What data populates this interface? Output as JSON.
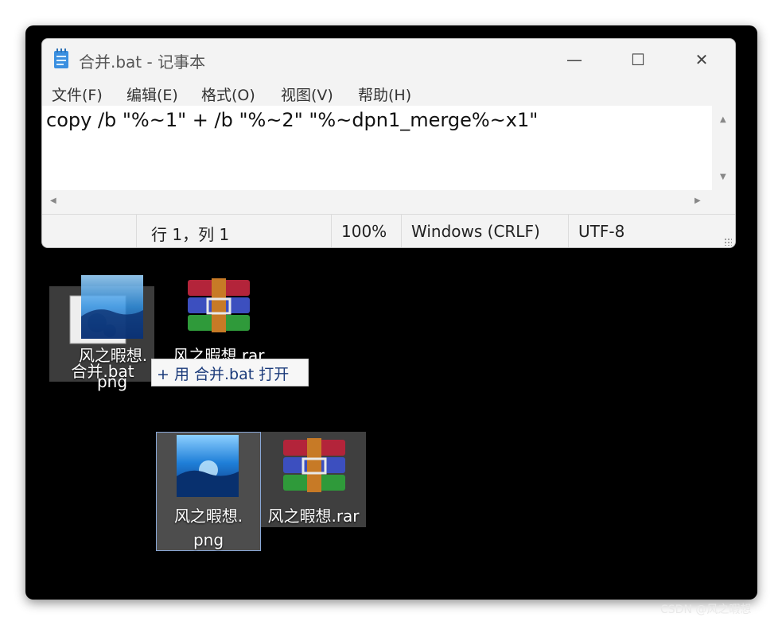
{
  "notepad": {
    "title": "合并.bat - 记事本",
    "controls": {
      "minimize": "—",
      "maximize": "☐",
      "close": "✕"
    },
    "menu": [
      "文件(F)",
      "编辑(E)",
      "格式(O)",
      "视图(V)",
      "帮助(H)"
    ],
    "content": "copy /b \"%~1\" + /b \"%~2\" \"%~dpn1_merge%~x1\"",
    "status": {
      "position": "行 1，列 1",
      "zoom": "100%",
      "line_ending": "Windows (CRLF)",
      "encoding": "UTF-8"
    }
  },
  "desktop": {
    "drag_labels": {
      "top": "风之暇想.",
      "middle": "合并.bat",
      "bottom": "png"
    },
    "rar_top_label": "风之暇想.rar",
    "tooltip": "+ 用 合并.bat 打开",
    "png_label_line1": "风之暇想.",
    "png_label_line2": "png",
    "rar_bottom_label": "风之暇想.rar"
  },
  "watermark": "CSDN @风之暇想",
  "colors": {
    "desktop": "#000000",
    "window": "#f3f3f3",
    "selection_border": "#8aa8d6"
  }
}
